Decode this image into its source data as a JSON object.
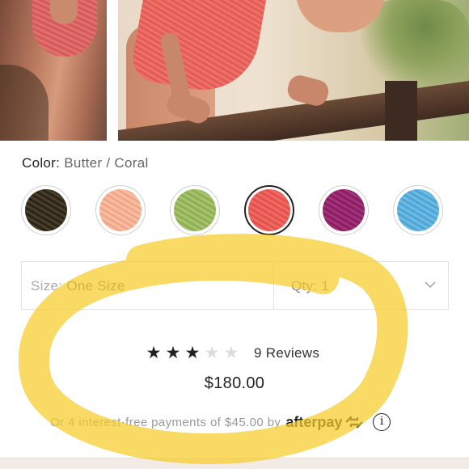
{
  "product": {
    "color_label": "Color:",
    "color_value": "Butter / Coral",
    "swatches": [
      {
        "name": "brown"
      },
      {
        "name": "peach"
      },
      {
        "name": "green"
      },
      {
        "name": "coral",
        "selected": true
      },
      {
        "name": "magenta"
      },
      {
        "name": "blue"
      }
    ],
    "size_label": "Size:",
    "size_value": "One Size",
    "qty_label": "Qty: 1",
    "rating_stars": 3,
    "rating_max": 5,
    "reviews_text": "9 Reviews",
    "price": "$180.00",
    "afterpay_prefix": "Or 4 interest-free payments of",
    "afterpay_amount": "$45.00",
    "afterpay_by": "by",
    "afterpay_brand": "afterpay"
  },
  "colors": {
    "highlight": "#f5cc2a",
    "selected_swatch_border": "#222222"
  }
}
